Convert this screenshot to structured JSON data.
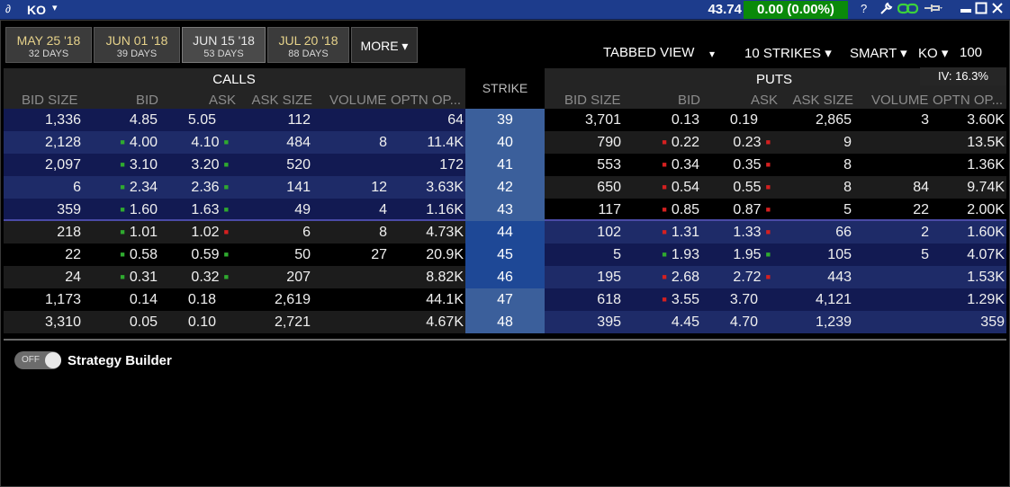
{
  "titlebar": {
    "chain_icon": "link-icon",
    "symbol": "KO",
    "symbol_arrow": "▾",
    "last_price": "43.74",
    "change": "0.00 (0.00%)",
    "help": "?",
    "wrench": "🔧",
    "chain": "⛓",
    "pin": "📌",
    "minimize": "▬",
    "maximize": "□",
    "close": "✕",
    "change_color": "#0a8a0a",
    "bar_color": "#1d3c8c"
  },
  "expiries": [
    {
      "date": "MAY 25 '18",
      "days": "32 DAYS"
    },
    {
      "date": "JUN 01 '18",
      "days": "39 DAYS"
    },
    {
      "date": "JUN 15 '18",
      "days": "53 DAYS"
    },
    {
      "date": "JUL 20 '18",
      "days": "88 DAYS"
    }
  ],
  "more_label": "MORE ▾",
  "toolbar": {
    "view": "TABBED VIEW",
    "view_arrow": "▾",
    "strikes": "10 STRIKES ▾",
    "exchange": "SMART ▾",
    "underlying": "KO ▾",
    "multiplier": "100",
    "iv": "IV: 16.3%"
  },
  "headers": {
    "calls": "CALLS",
    "puts": "PUTS",
    "strike": "STRIKE",
    "call_cols": [
      "BID SIZE",
      "BID",
      "ASK",
      "ASK SIZE",
      "VOLUME",
      "OPTN OP..."
    ],
    "put_cols": [
      "BID SIZE",
      "BID",
      "ASK",
      "ASK SIZE",
      "VOLUME",
      "OPTN OP..."
    ]
  },
  "rows": [
    {
      "strike": "39",
      "c_bs": "1,336",
      "c_bid": "4.85",
      "c_bt": "",
      "c_ask": "5.05",
      "c_at": "",
      "c_as": "112",
      "c_vol": "",
      "c_oi": "64",
      "p_bs": "3,701",
      "p_bid": "0.13",
      "p_bt": "",
      "p_ask": "0.19",
      "p_at": "",
      "p_as": "2,865",
      "p_vol": "3",
      "p_oi": "3.60K"
    },
    {
      "strike": "40",
      "c_bs": "2,128",
      "c_bid": "4.00",
      "c_bt": "up",
      "c_ask": "4.10",
      "c_at": "up",
      "c_as": "484",
      "c_vol": "8",
      "c_oi": "11.4K",
      "p_bs": "790",
      "p_bid": "0.22",
      "p_bt": "down",
      "p_ask": "0.23",
      "p_at": "down",
      "p_as": "9",
      "p_vol": "",
      "p_oi": "13.5K"
    },
    {
      "strike": "41",
      "c_bs": "2,097",
      "c_bid": "3.10",
      "c_bt": "up",
      "c_ask": "3.20",
      "c_at": "up",
      "c_as": "520",
      "c_vol": "",
      "c_oi": "172",
      "p_bs": "553",
      "p_bid": "0.34",
      "p_bt": "down",
      "p_ask": "0.35",
      "p_at": "down",
      "p_as": "8",
      "p_vol": "",
      "p_oi": "1.36K"
    },
    {
      "strike": "42",
      "c_bs": "6",
      "c_bid": "2.34",
      "c_bt": "up",
      "c_ask": "2.36",
      "c_at": "up",
      "c_as": "141",
      "c_vol": "12",
      "c_oi": "3.63K",
      "p_bs": "650",
      "p_bid": "0.54",
      "p_bt": "down",
      "p_ask": "0.55",
      "p_at": "down",
      "p_as": "8",
      "p_vol": "84",
      "p_oi": "9.74K"
    },
    {
      "strike": "43",
      "c_bs": "359",
      "c_bid": "1.60",
      "c_bt": "up",
      "c_ask": "1.63",
      "c_at": "up",
      "c_as": "49",
      "c_vol": "4",
      "c_oi": "1.16K",
      "p_bs": "117",
      "p_bid": "0.85",
      "p_bt": "down",
      "p_ask": "0.87",
      "p_at": "down",
      "p_as": "5",
      "p_vol": "22",
      "p_oi": "2.00K"
    },
    {
      "strike": "44",
      "c_bs": "218",
      "c_bid": "1.01",
      "c_bt": "up",
      "c_ask": "1.02",
      "c_at": "down",
      "c_as": "6",
      "c_vol": "8",
      "c_oi": "4.73K",
      "p_bs": "102",
      "p_bid": "1.31",
      "p_bt": "down",
      "p_ask": "1.33",
      "p_at": "down",
      "p_as": "66",
      "p_vol": "2",
      "p_oi": "1.60K"
    },
    {
      "strike": "45",
      "c_bs": "22",
      "c_bid": "0.58",
      "c_bt": "up",
      "c_ask": "0.59",
      "c_at": "up",
      "c_as": "50",
      "c_vol": "27",
      "c_oi": "20.9K",
      "p_bs": "5",
      "p_bid": "1.93",
      "p_bt": "up",
      "p_ask": "1.95",
      "p_at": "up",
      "p_as": "105",
      "p_vol": "5",
      "p_oi": "4.07K"
    },
    {
      "strike": "46",
      "c_bs": "24",
      "c_bid": "0.31",
      "c_bt": "up",
      "c_ask": "0.32",
      "c_at": "up",
      "c_as": "207",
      "c_vol": "",
      "c_oi": "8.82K",
      "p_bs": "195",
      "p_bid": "2.68",
      "p_bt": "down",
      "p_ask": "2.72",
      "p_at": "down",
      "p_as": "443",
      "p_vol": "",
      "p_oi": "1.53K"
    },
    {
      "strike": "47",
      "c_bs": "1,173",
      "c_bid": "0.14",
      "c_bt": "",
      "c_ask": "0.18",
      "c_at": "",
      "c_as": "2,619",
      "c_vol": "",
      "c_oi": "44.1K",
      "p_bs": "618",
      "p_bid": "3.55",
      "p_bt": "down",
      "p_ask": "3.70",
      "p_at": "",
      "p_as": "4,121",
      "p_vol": "",
      "p_oi": "1.29K"
    },
    {
      "strike": "48",
      "c_bs": "3,310",
      "c_bid": "0.05",
      "c_bt": "",
      "c_ask": "0.10",
      "c_at": "",
      "c_as": "2,721",
      "c_vol": "",
      "c_oi": "4.67K",
      "p_bs": "395",
      "p_bid": "4.45",
      "p_bt": "",
      "p_ask": "4.70",
      "p_at": "",
      "p_as": "1,239",
      "p_vol": "",
      "p_oi": "359"
    }
  ],
  "strategy_builder": {
    "toggle_state": "OFF",
    "label": "Strategy Builder"
  },
  "colors": {
    "strike_itm": "#1e4896",
    "strike_otm": "#3b5f9b",
    "itm_row_a": "#121a52",
    "itm_row_b": "#1e2b68",
    "otm_row_a": "#000000",
    "otm_row_b": "#1c1c1c",
    "tick_up": "#2faa2f",
    "tick_down": "#d52020"
  }
}
